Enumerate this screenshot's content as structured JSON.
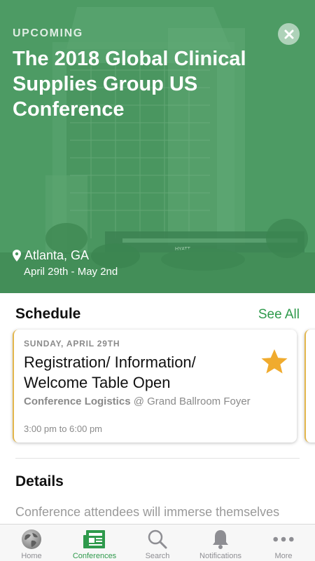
{
  "hero": {
    "status": "UPCOMING",
    "title": "The 2018 Global Clinical Supplies Group US Conference",
    "location": "Atlanta, GA",
    "dates": "April 29th - May 2nd",
    "sign_text": "HYATT",
    "overlay_color": "#4a9660"
  },
  "schedule": {
    "heading": "Schedule",
    "see_all": "See All",
    "card": {
      "day": "SUNDAY, APRIL 29TH",
      "title": "Registration/ Information/ Welcome Table Open",
      "track": "Conference Logistics",
      "at": " @ Grand Ballroom Foyer",
      "time": "3:00 pm to 6:00 pm",
      "starred": true,
      "star_color": "#f0ab2e"
    }
  },
  "details": {
    "heading": "Details",
    "body": "Conference attendees will immerse themselves"
  },
  "tabs": [
    {
      "label": "Home",
      "icon": "globe-icon",
      "active": false
    },
    {
      "label": "Conferences",
      "icon": "newspaper-icon",
      "active": true
    },
    {
      "label": "Search",
      "icon": "search-icon",
      "active": false
    },
    {
      "label": "Notifications",
      "icon": "bell-icon",
      "active": false
    },
    {
      "label": "More",
      "icon": "more-dots-icon",
      "active": false
    }
  ],
  "colors": {
    "accent": "#2f9a4c",
    "card_edge": "#e3b64b",
    "muted": "#8a8a8a"
  }
}
